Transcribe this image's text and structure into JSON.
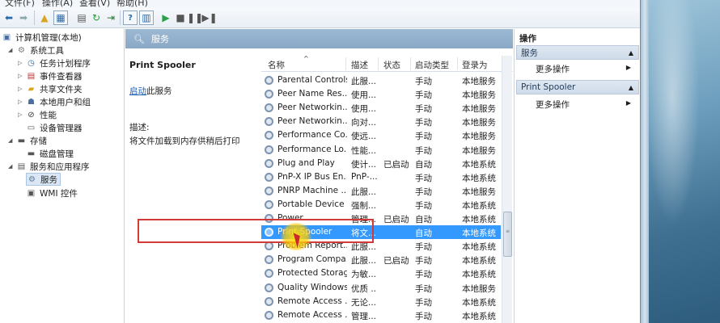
{
  "menu": [
    "文件(F)",
    "操作(A)",
    "查看(V)",
    "帮助(H)"
  ],
  "tree": {
    "root": "计算机管理(本地)",
    "system_tools": "系统工具",
    "task_scheduler": "任务计划程序",
    "event_viewer": "事件查看器",
    "shared_folders": "共享文件夹",
    "local_users": "本地用户和组",
    "performance": "性能",
    "device_manager": "设备管理器",
    "storage": "存储",
    "disk_management": "磁盘管理",
    "services_apps": "服务和应用程序",
    "services": "服务",
    "wmi": "WMI 控件"
  },
  "center": {
    "header": "服务",
    "selected_name": "Print Spooler",
    "start_link": "启动",
    "start_suffix": "此服务",
    "desc_label": "描述:",
    "desc_text": "将文件加载到内存供稍后打印"
  },
  "columns": {
    "name": "名称",
    "desc": "描述",
    "status": "状态",
    "startup": "启动类型",
    "logon": "登录为"
  },
  "rows": [
    {
      "name": "Parental Controls",
      "desc": "此服...",
      "status": "",
      "startup": "手动",
      "logon": "本地服务"
    },
    {
      "name": "Peer Name Res...",
      "desc": "使用...",
      "status": "",
      "startup": "手动",
      "logon": "本地服务"
    },
    {
      "name": "Peer Networkin...",
      "desc": "使用...",
      "status": "",
      "startup": "手动",
      "logon": "本地服务"
    },
    {
      "name": "Peer Networkin...",
      "desc": "向对...",
      "status": "",
      "startup": "手动",
      "logon": "本地服务"
    },
    {
      "name": "Performance Co...",
      "desc": "使远...",
      "status": "",
      "startup": "手动",
      "logon": "本地服务"
    },
    {
      "name": "Performance Lo...",
      "desc": "性能...",
      "status": "",
      "startup": "手动",
      "logon": "本地服务"
    },
    {
      "name": "Plug and Play",
      "desc": "使计...",
      "status": "已启动",
      "startup": "自动",
      "logon": "本地系统"
    },
    {
      "name": "PnP-X IP Bus En...",
      "desc": "PnP-...",
      "status": "",
      "startup": "手动",
      "logon": "本地系统"
    },
    {
      "name": "PNRP Machine ...",
      "desc": "此服...",
      "status": "",
      "startup": "手动",
      "logon": "本地服务"
    },
    {
      "name": "Portable Device ...",
      "desc": "强制...",
      "status": "",
      "startup": "手动",
      "logon": "本地系统"
    },
    {
      "name": "Power",
      "desc": "管理...",
      "status": "已启动",
      "startup": "自动",
      "logon": "本地系统"
    },
    {
      "name": "Print Spooler",
      "desc": "将文...",
      "status": "",
      "startup": "自动",
      "logon": "本地系统"
    },
    {
      "name": "Problem Report...",
      "desc": "此服...",
      "status": "",
      "startup": "手动",
      "logon": "本地系统"
    },
    {
      "name": "Program Compa...",
      "desc": "此服...",
      "status": "已启动",
      "startup": "手动",
      "logon": "本地系统"
    },
    {
      "name": "Protected Storage",
      "desc": "为敏...",
      "status": "",
      "startup": "手动",
      "logon": "本地系统"
    },
    {
      "name": "Quality Windows...",
      "desc": "优质 ...",
      "status": "",
      "startup": "手动",
      "logon": "本地服务"
    },
    {
      "name": "Remote Access ...",
      "desc": "无论...",
      "status": "",
      "startup": "手动",
      "logon": "本地系统"
    },
    {
      "name": "Remote Access ...",
      "desc": "管理...",
      "status": "",
      "startup": "手动",
      "logon": "本地系统"
    }
  ],
  "actions": {
    "title": "操作",
    "section1": "服务",
    "more1": "更多操作",
    "section2": "Print Spooler",
    "more2": "更多操作"
  }
}
